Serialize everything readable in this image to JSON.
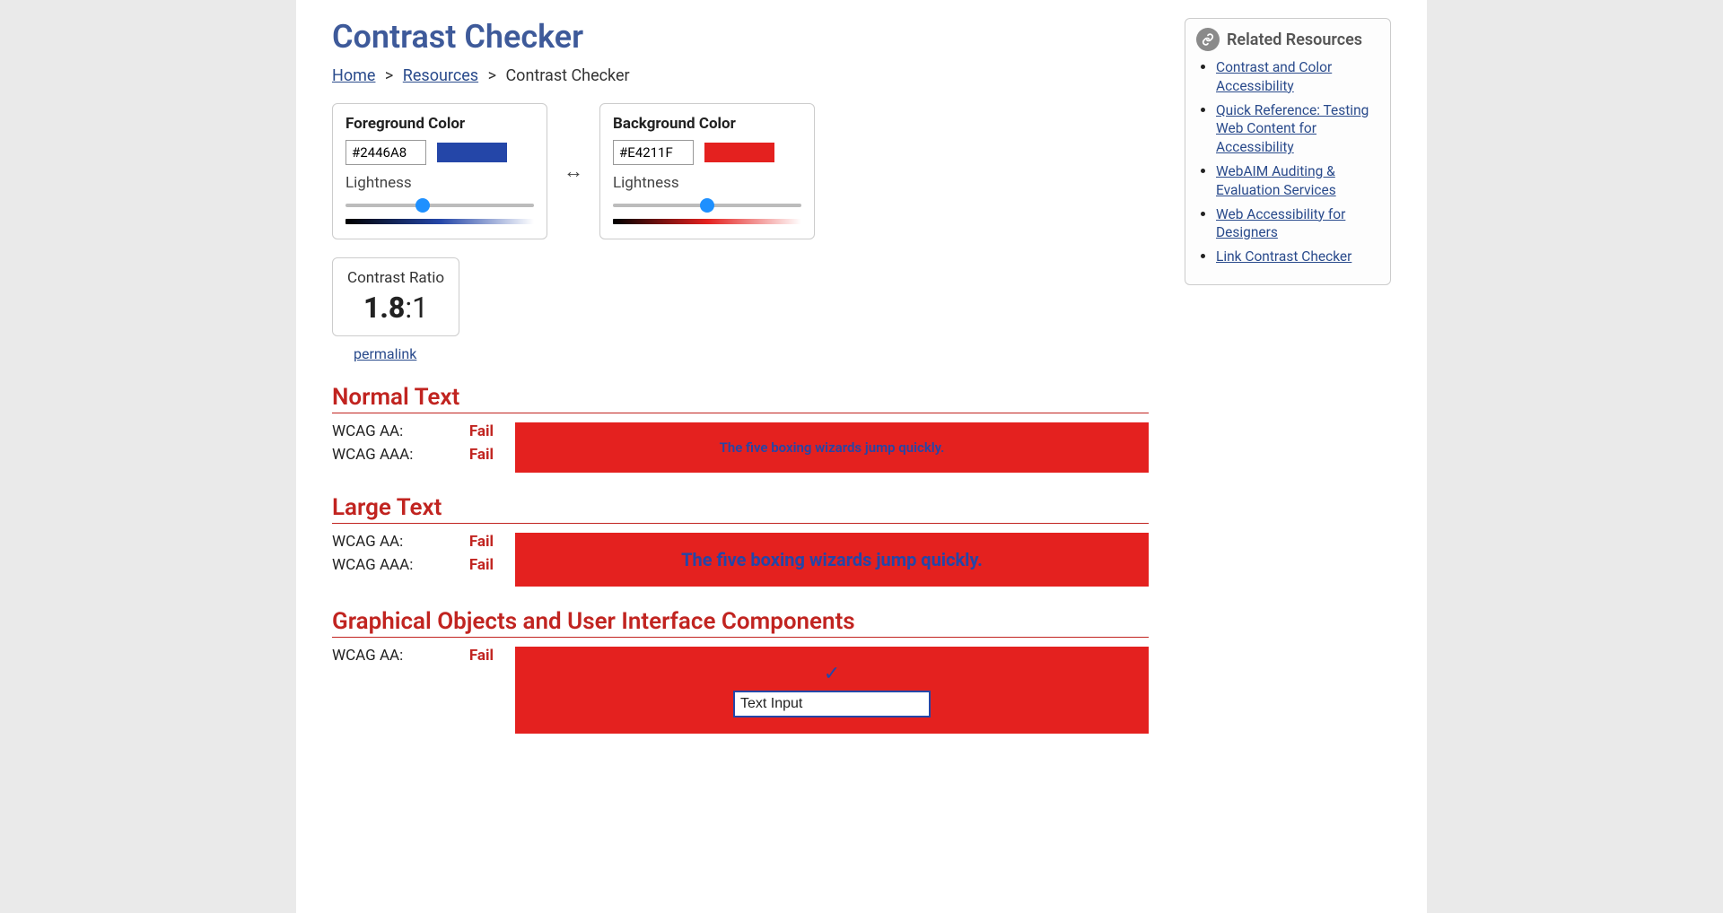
{
  "title": "Contrast Checker",
  "breadcrumb": {
    "home": "Home",
    "resources": "Resources",
    "current": "Contrast Checker"
  },
  "foreground": {
    "label": "Foreground Color",
    "hex": "#2446A8",
    "lightness_label": "Lightness",
    "lightness_value": 40
  },
  "background": {
    "label": "Background Color",
    "hex": "#E4211F",
    "lightness_label": "Lightness",
    "lightness_value": 50
  },
  "contrast_ratio": {
    "label": "Contrast Ratio",
    "value": "1.8",
    "suffix": ":1",
    "permalink": "permalink"
  },
  "sections": {
    "normal": {
      "heading": "Normal Text",
      "aa_label": "WCAG AA:",
      "aa_status": "Fail",
      "aaa_label": "WCAG AAA:",
      "aaa_status": "Fail",
      "sample": "The five boxing wizards jump quickly."
    },
    "large": {
      "heading": "Large Text",
      "aa_label": "WCAG AA:",
      "aa_status": "Fail",
      "aaa_label": "WCAG AAA:",
      "aaa_status": "Fail",
      "sample": "The five boxing wizards jump quickly."
    },
    "ui": {
      "heading": "Graphical Objects and User Interface Components",
      "aa_label": "WCAG AA:",
      "aa_status": "Fail",
      "input_value": "Text Input"
    }
  },
  "sidebar": {
    "title": "Related Resources",
    "links": [
      "Contrast and Color Accessibility",
      "Quick Reference: Testing Web Content for Accessibility",
      "WebAIM Auditing & Evaluation Services",
      "Web Accessibility for Designers",
      "Link Contrast Checker"
    ]
  },
  "colors": {
    "fg_hex": "#2446A8",
    "bg_hex": "#E4211F"
  }
}
